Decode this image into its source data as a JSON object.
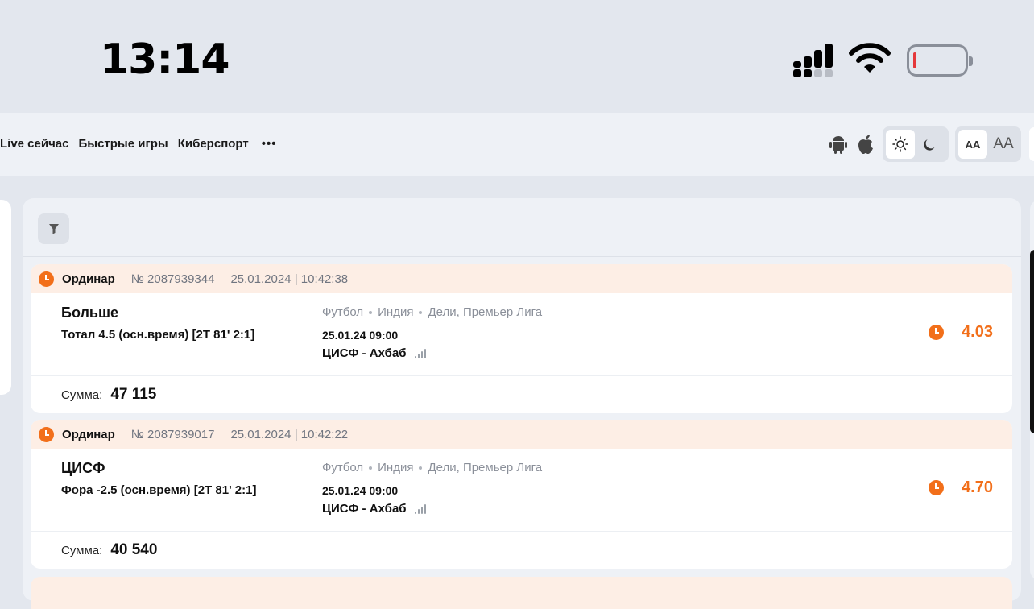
{
  "status_bar": {
    "time": "13:14"
  },
  "nav": {
    "links": [
      "Live сейчас",
      "Быстрые игры",
      "Киберспорт"
    ],
    "more": "•••",
    "font_small": "AA",
    "font_large": "AA"
  },
  "bets": [
    {
      "type": "Ординар",
      "number": "№ 2087939344",
      "datetime": "25.01.2024 | 10:42:38",
      "outcome": "Больше",
      "market": "Тотал 4.5 (осн.время) [2Т 81' 2:1]",
      "sport": "Футбол",
      "country": "Индия",
      "league": "Дели, Премьер Лига",
      "start": "25.01.24 09:00",
      "match": "ЦИСФ - Ахбаб",
      "odd": "4.03",
      "sum_label": "Сумма:",
      "sum": "47 115"
    },
    {
      "type": "Ординар",
      "number": "№ 2087939017",
      "datetime": "25.01.2024 | 10:42:22",
      "outcome": "ЦИСФ",
      "market": "Фора -2.5 (осн.время) [2Т 81' 2:1]",
      "sport": "Футбол",
      "country": "Индия",
      "league": "Дели, Премьер Лига",
      "start": "25.01.24 09:00",
      "match": "ЦИСФ - Ахбаб",
      "odd": "4.70",
      "sum_label": "Сумма:",
      "sum": "40 540"
    }
  ],
  "colors": {
    "accent": "#f26f1a",
    "header_bg": "#fdeee5",
    "page_bg": "#e3e7ee"
  }
}
